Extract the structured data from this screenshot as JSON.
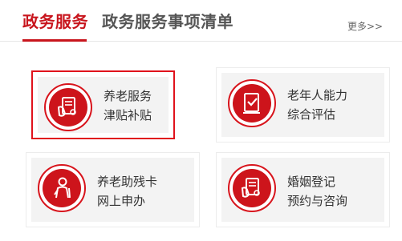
{
  "header": {
    "tabs": [
      {
        "label": "政务服务",
        "active": true
      },
      {
        "label": "政务服务事项清单",
        "active": false
      }
    ],
    "more_label": "更多>>"
  },
  "services": [
    {
      "line1": "养老服务",
      "line2": "津贴补贴",
      "icon": "hand-document-icon",
      "selected": true
    },
    {
      "line1": "老年人能力",
      "line2": "综合评估",
      "icon": "checked-document-icon",
      "selected": false
    },
    {
      "line1": "养老助残卡",
      "line2": "网上申办",
      "icon": "elderly-person-icon",
      "selected": false
    },
    {
      "line1": "婚姻登记",
      "line2": "预约与咨询",
      "icon": "hand-document-icon",
      "selected": false
    }
  ],
  "colors": {
    "accent": "#c8151d",
    "icon_red": "#cd141b",
    "card_bg": "#f3f3f3",
    "selected_border": "#e0121c"
  }
}
